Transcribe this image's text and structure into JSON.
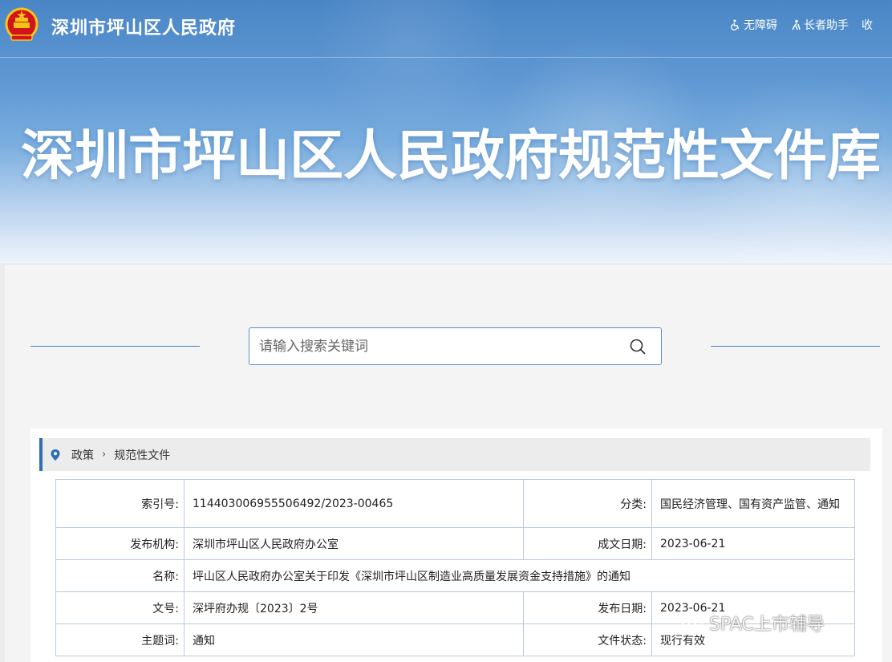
{
  "header": {
    "site_name": "深圳市坪山区人民政府",
    "toolbar": [
      {
        "label": "无障碍",
        "icon": "accessibility-icon"
      },
      {
        "label": "长者助手",
        "icon": "elder-helper-icon"
      },
      {
        "label": "收",
        "icon": ""
      }
    ],
    "hero_title": "深圳市坪山区人民政府规范性文件库"
  },
  "search": {
    "placeholder": "请输入搜索关键词"
  },
  "breadcrumb": {
    "items": [
      "政策",
      "规范性文件"
    ]
  },
  "info": {
    "index_label": "索引号:",
    "index_value": "114403006955506492/2023-00465",
    "category_label": "分类:",
    "category_value": "国民经济管理、国有资产监管、通知",
    "publisher_label": "发布机构:",
    "publisher_value": "深圳市坪山区人民政府办公室",
    "written_date_label": "成文日期:",
    "written_date_value": "2023-06-21",
    "name_label": "名称:",
    "name_value": "坪山区人民政府办公室关于印发《深圳市坪山区制造业高质量发展资金支持措施》的通知",
    "doc_no_label": "文号:",
    "doc_no_value": "深坪府办规〔2023〕2号",
    "publish_date_label": "发布日期:",
    "publish_date_value": "2023-06-21",
    "subject_label": "主题词:",
    "subject_value": "通知",
    "status_label": "文件状态:",
    "status_value": "现行有效"
  },
  "watermark": {
    "text": "SPAC上市辅导"
  },
  "colors": {
    "accent": "#2f6db5",
    "border": "#b8cbdd",
    "emblem_red": "#d3141c",
    "emblem_gold": "#f5c518"
  }
}
